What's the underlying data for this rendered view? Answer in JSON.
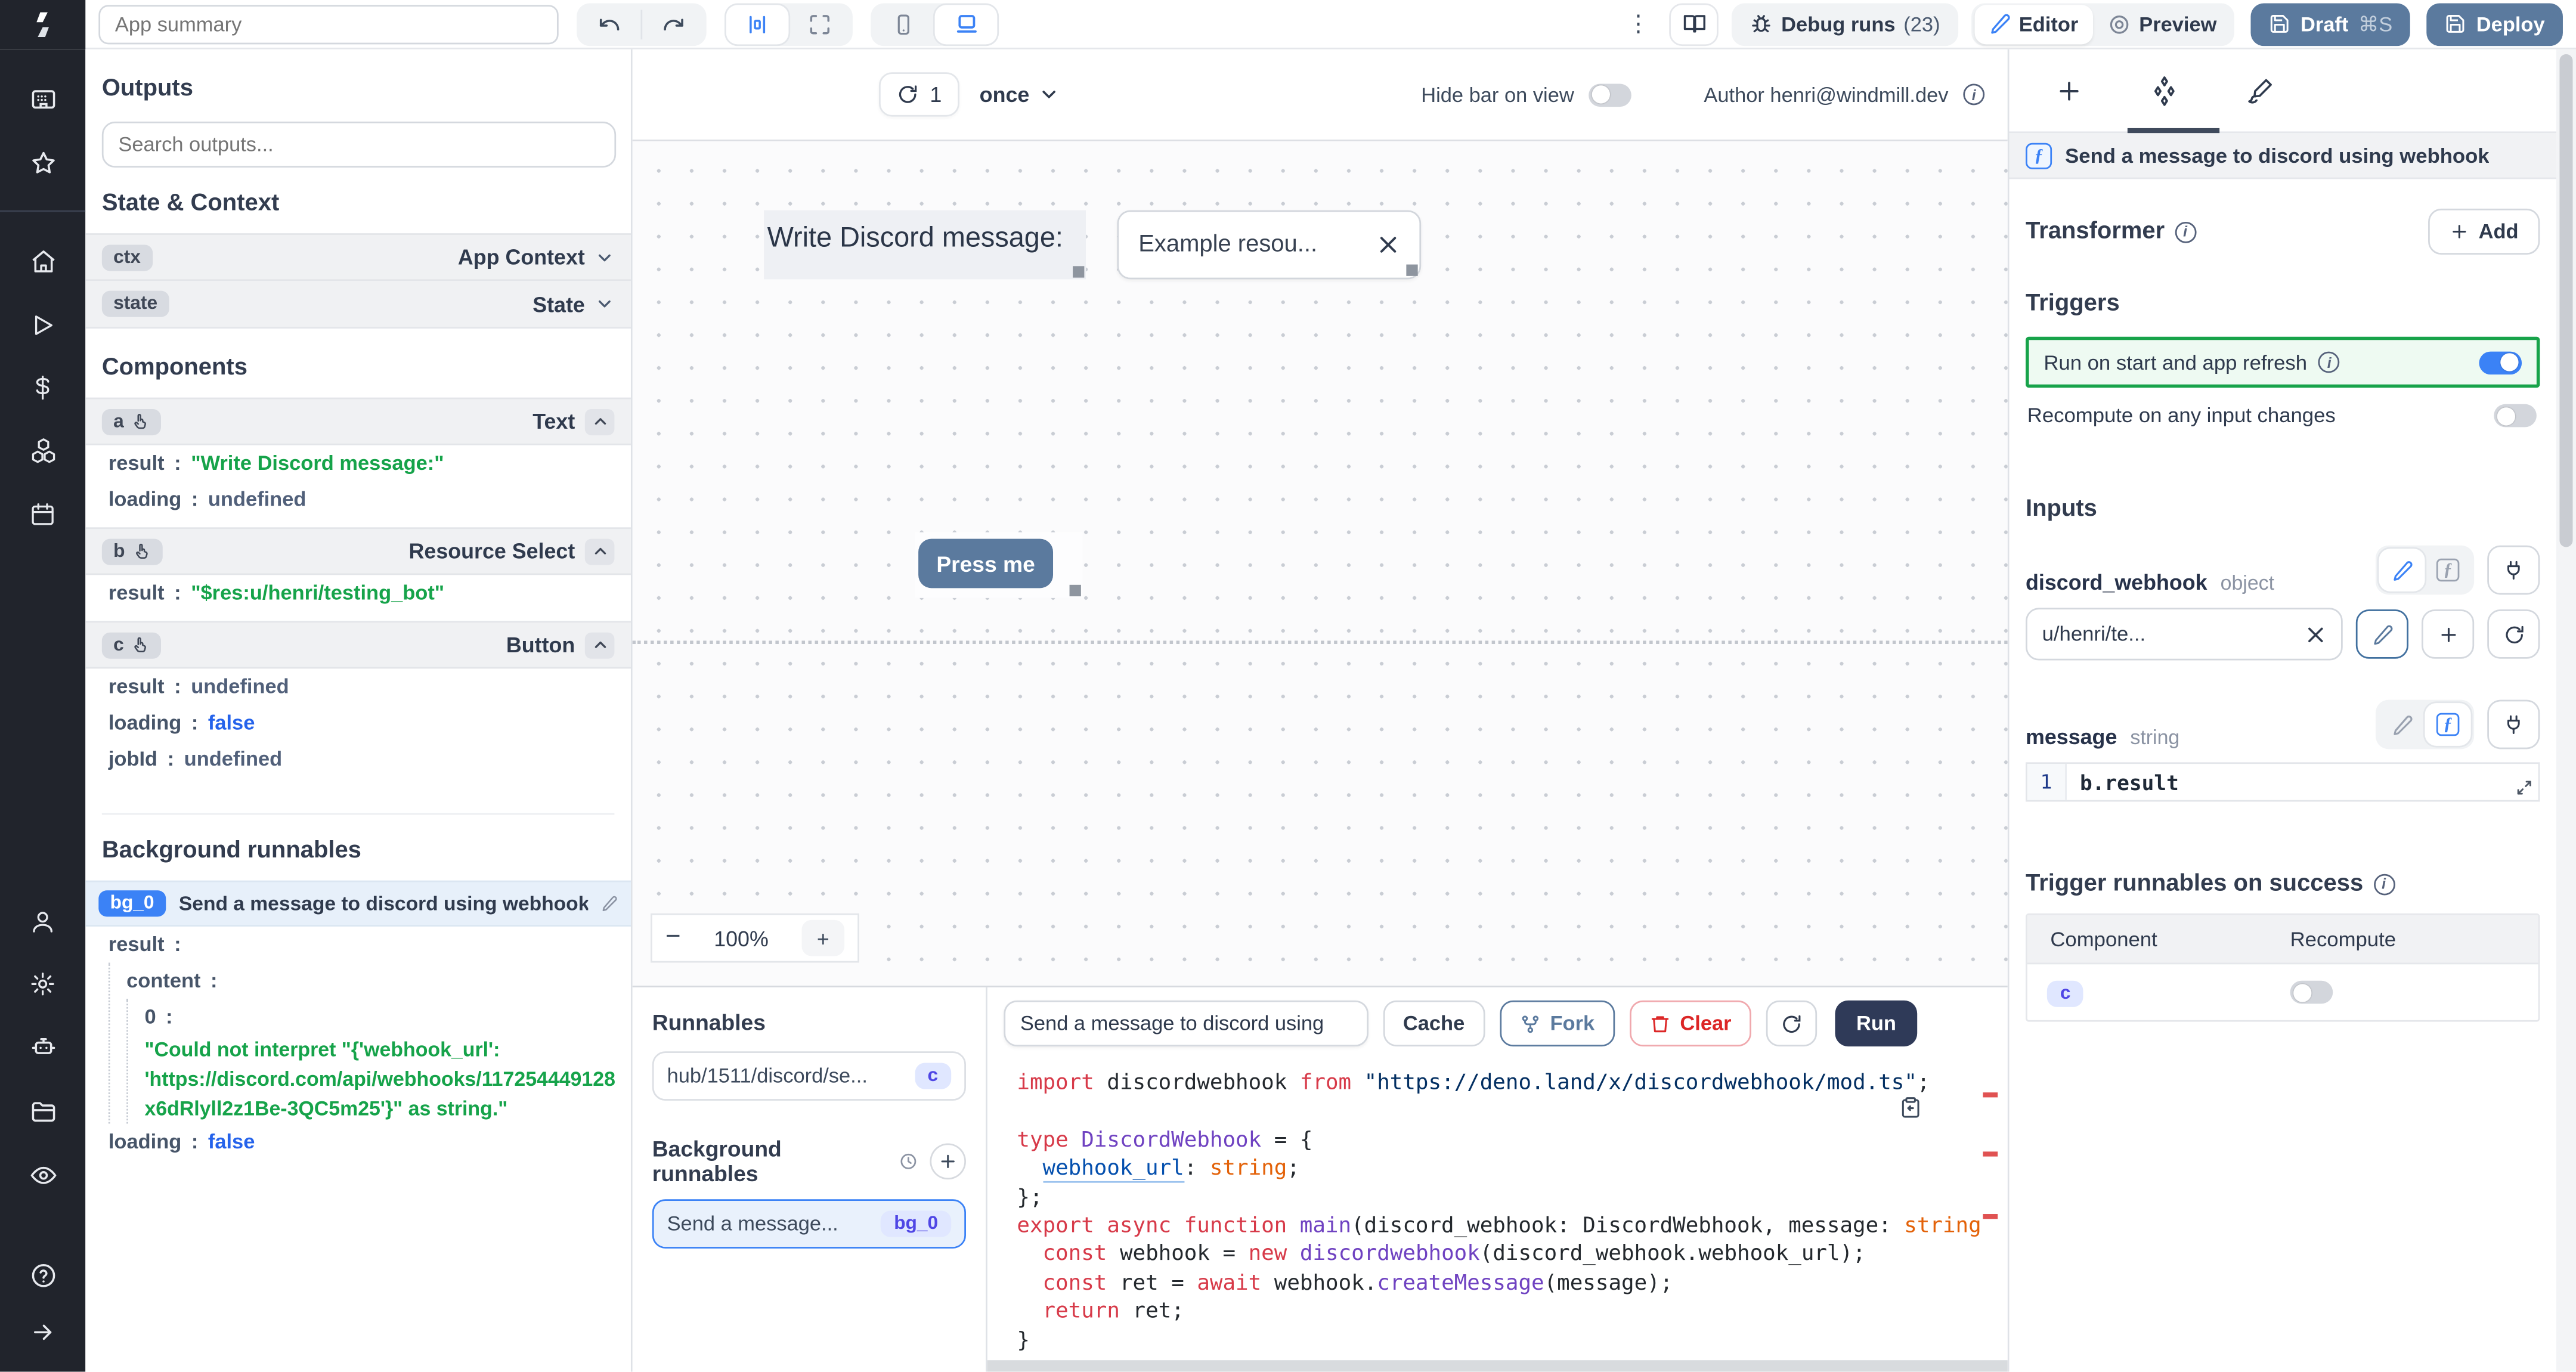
{
  "topbar": {
    "app_summary_placeholder": "App summary",
    "menu_icon": "⋮",
    "debug_runs_label": "Debug runs",
    "debug_runs_count": "(23)",
    "editor_label": "Editor",
    "preview_label": "Preview",
    "draft_label": "Draft",
    "draft_shortcut": "⌘S",
    "deploy_label": "Deploy"
  },
  "canvas_header": {
    "refresh_count": "1",
    "run_mode": "once",
    "hide_bar_label": "Hide bar on view",
    "author_label": "Author henri@windmill.dev"
  },
  "canvas": {
    "text_component": "Write Discord message:",
    "resource_select_value": "Example resou...",
    "button_label": "Press me",
    "zoom_level": "100%",
    "zoom_minus": "−",
    "zoom_plus": "+"
  },
  "outputs_panel": {
    "title": "Outputs",
    "search_placeholder": "Search outputs...",
    "state_context_title": "State & Context",
    "ctx": {
      "key": "ctx",
      "type": "App Context"
    },
    "state": {
      "key": "state",
      "type": "State"
    },
    "components_title": "Components",
    "comp_a": {
      "id": "a",
      "type": "Text",
      "rows": [
        {
          "k": "result",
          "v": "\"Write Discord message:\""
        },
        {
          "k": "loading",
          "v": "undefined"
        }
      ]
    },
    "comp_b": {
      "id": "b",
      "type": "Resource Select",
      "rows": [
        {
          "k": "result",
          "v": "\"$res:u/henri/testing_bot\""
        }
      ]
    },
    "comp_c": {
      "id": "c",
      "type": "Button",
      "rows": [
        {
          "k": "result",
          "v": "undefined"
        },
        {
          "k": "loading",
          "v": "false"
        },
        {
          "k": "jobId",
          "v": "undefined"
        }
      ]
    },
    "background_title": "Background runnables",
    "bg0": {
      "id": "bg_0",
      "name": "Send a message to discord using webhook",
      "result_key": "result",
      "content_key": "content",
      "index_key": "0",
      "value_lines": [
        "\"Could not interpret \"{'webhook_url':",
        "'https://discord.com/api/webhooks/117254449128",
        "x6dRlyll2z1Be-3QC5m25'}\" as string.\""
      ],
      "loading_key": "loading",
      "loading_value": "false"
    }
  },
  "runnables_panel": {
    "title": "Runnables",
    "hub_item_label": "hub/1511/discord/se...",
    "hub_item_badge": "c",
    "background_title": "Background runnables",
    "bg_item_label": "Send a message...",
    "bg_item_badge": "bg_0"
  },
  "code_panel": {
    "script_name": "Send a message to discord using",
    "cache_label": "Cache",
    "fork_label": "Fork",
    "clear_label": "Clear",
    "run_label": "Run",
    "lines": [
      [
        [
          "k",
          "import "
        ],
        [
          "i",
          "discordwebhook "
        ],
        [
          "k",
          "from "
        ],
        [
          "s",
          "\"https://deno.land/x/discordwebhook/mod.ts\""
        ],
        [
          "p",
          ";"
        ]
      ],
      [],
      [
        [
          "k",
          "type "
        ],
        [
          "t",
          "DiscordWebhook"
        ],
        [
          "p",
          " = {"
        ]
      ],
      [
        [
          "p",
          "  "
        ],
        [
          "v",
          "webhook_url"
        ],
        [
          "p",
          ": "
        ],
        [
          "o",
          "string"
        ],
        [
          "p",
          ";"
        ]
      ],
      [
        [
          "p",
          "};"
        ]
      ],
      [
        [
          "k",
          "export async function "
        ],
        [
          "f",
          "main"
        ],
        [
          "p",
          "(discord_webhook: DiscordWebhook, message: "
        ],
        [
          "o",
          "string"
        ]
      ],
      [
        [
          "p",
          "  "
        ],
        [
          "k",
          "const "
        ],
        [
          "p",
          "webhook = "
        ],
        [
          "k",
          "new "
        ],
        [
          "t",
          "discordwebhook"
        ],
        [
          "p",
          "(discord_webhook.webhook_url);"
        ]
      ],
      [
        [
          "p",
          "  "
        ],
        [
          "k",
          "const "
        ],
        [
          "p",
          "ret = "
        ],
        [
          "k",
          "await "
        ],
        [
          "p",
          "webhook."
        ],
        [
          "f",
          "createMessage"
        ],
        [
          "p",
          "(message);"
        ]
      ],
      [
        [
          "p",
          "  "
        ],
        [
          "k",
          "return "
        ],
        [
          "p",
          "ret;"
        ]
      ],
      [
        [
          "p",
          "}"
        ]
      ]
    ]
  },
  "right_panel": {
    "header_title": "Send a message to discord using webhook",
    "transformer_label": "Transformer",
    "add_label": "Add",
    "triggers_title": "Triggers",
    "run_on_start_label": "Run on start and app refresh",
    "recompute_label": "Recompute on any input changes",
    "inputs_title": "Inputs",
    "field1": {
      "name": "discord_webhook",
      "type": "object",
      "value": "u/henri/te..."
    },
    "field2": {
      "name": "message",
      "type": "string",
      "line_number": "1",
      "expression": "b.result"
    },
    "trigger_success_title": "Trigger runnables on success",
    "table": {
      "col1": "Component",
      "col2": "Recompute",
      "row_component": "c"
    }
  },
  "colors": {
    "accent": "#3b82f6",
    "slate_button": "#5b7a9e",
    "run_button": "#2f3a58",
    "string_green": "#16a34a",
    "link_blue": "#2563eb"
  }
}
